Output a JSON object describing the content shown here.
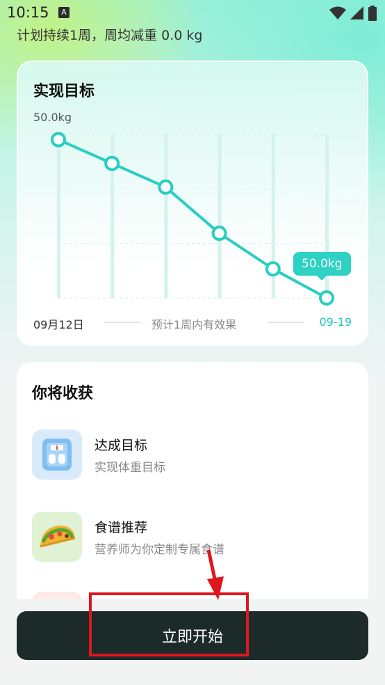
{
  "status_bar": {
    "time": "10:15",
    "notification_icon": "A",
    "icons": [
      "wifi-icon",
      "signal-icon",
      "battery-icon"
    ]
  },
  "plan_summary": "计划持续1周，周均减重 0.0 kg",
  "goal_card": {
    "title": "实现目标",
    "start_date": "09月12日",
    "middle_text": "预计1周内有效果",
    "end_date": "09-19",
    "tooltip": "50.0kg"
  },
  "chart_data": {
    "type": "line",
    "title": "",
    "y_label": "50.0kg",
    "x_labels": [
      "09月12日",
      "09-19"
    ],
    "values": [
      6,
      5.1,
      4.2,
      2.45,
      1.1,
      0
    ],
    "ylim": [
      0,
      6.2
    ],
    "grid": true,
    "color": "#26cfc1",
    "annotation": "50.0kg"
  },
  "gains_card": {
    "title": "你将收获",
    "items": [
      {
        "title": "达成目标",
        "desc": "实现体重目标",
        "icon": "scale-icon",
        "icon_bg": "#d9ebfb"
      },
      {
        "title": "食谱推荐",
        "desc": "营养师为你定制专属食谱",
        "icon": "taco-icon",
        "icon_bg": "#dff2d4"
      }
    ]
  },
  "cta": {
    "label": "立即开始"
  },
  "colors": {
    "accent": "#26cfc1",
    "button_bg": "#1c2a2a",
    "annotation": "#e0161e"
  }
}
